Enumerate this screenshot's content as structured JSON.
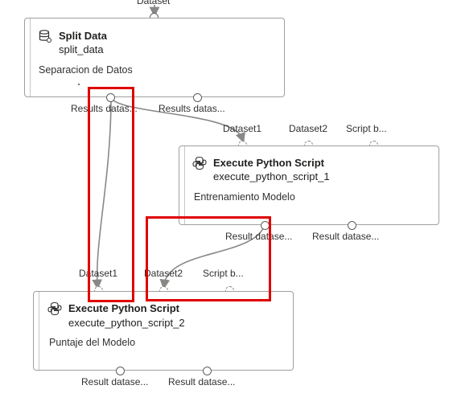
{
  "top_port_label": "Dataset",
  "nodes": {
    "split": {
      "title": "Split Data",
      "subtitle": "split_data",
      "comment": "Separacion de Datos",
      "outputs": [
        "Results datas...",
        "Results datas..."
      ]
    },
    "python1": {
      "title": "Execute Python Script",
      "subtitle": "execute_python_script_1",
      "comment": "Entrenamiento Modelo",
      "inputs": [
        "Dataset1",
        "Dataset2",
        "Script b..."
      ],
      "outputs": [
        "Result datase...",
        "Result datase..."
      ]
    },
    "python2": {
      "title": "Execute Python Script",
      "subtitle": "execute_python_script_2",
      "comment": "Puntaje del Modelo",
      "inputs": [
        "Dataset1",
        "Dataset2",
        "Script b..."
      ],
      "outputs": [
        "Result datase...",
        "Result datase..."
      ]
    }
  },
  "colors": {
    "highlight": "#e00000",
    "edge": "#8a8886",
    "node_border": "#a19f9d"
  },
  "icons": {
    "split": "database-icon",
    "python": "python-icon"
  }
}
